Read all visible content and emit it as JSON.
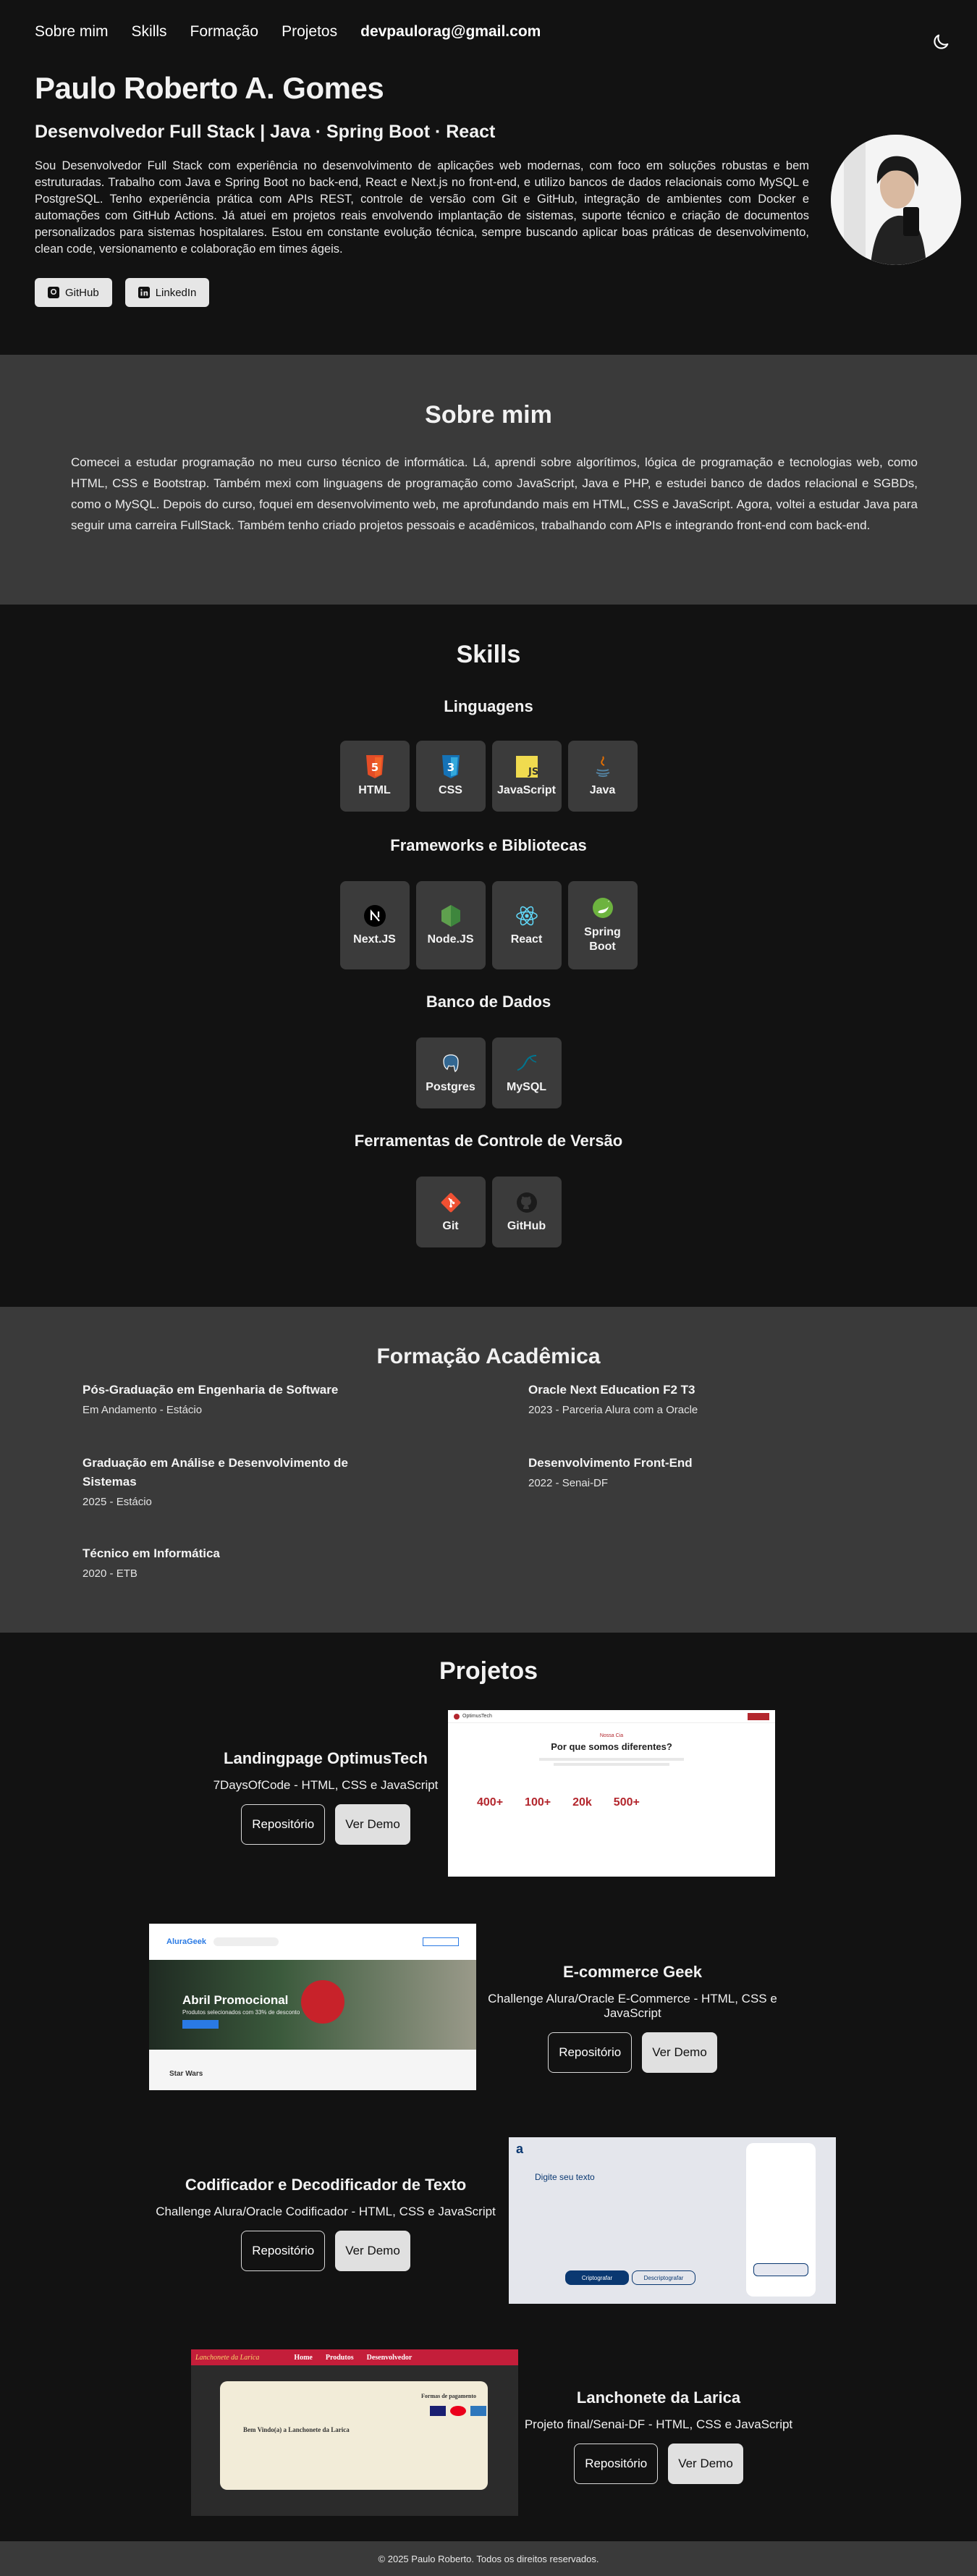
{
  "nav": {
    "items": [
      "Sobre mim",
      "Skills",
      "Formação",
      "Projetos"
    ],
    "email": "devpaulorag@gmail.com"
  },
  "header": {
    "name": "Paulo Roberto A. Gomes",
    "role": "Desenvolvedor Full Stack | Java · Spring Boot · React",
    "bio": "Sou Desenvolvedor Full Stack com experiência no desenvolvimento de aplicações web modernas, com foco em soluções robustas e bem estruturadas. Trabalho com Java e Spring Boot no back-end, React e Next.js no front-end, e utilizo bancos de dados relacionais como MySQL e PostgreSQL. Tenho experiência prática com APIs REST, controle de versão com Git e GitHub, integração de ambientes com Docker e automações com GitHub Actions. Já atuei em projetos reais envolvendo implantação de sistemas, suporte técnico e criação de documentos personalizados para sistemas hospitalares. Estou em constante evolução técnica, sempre buscando aplicar boas práticas de desenvolvimento, clean code, versionamento e colaboração em times ágeis.",
    "github_label": "GitHub",
    "linkedin_label": "LinkedIn"
  },
  "about": {
    "title": "Sobre mim",
    "text": "Comecei a estudar programação no meu curso técnico de informática. Lá, aprendi sobre algorítimos, lógica de programação e tecnologias web, como HTML, CSS e Bootstrap. Também mexi com linguagens de programação como JavaScript, Java e PHP, e estudei banco de dados relacional e SGBDs, como o MySQL. Depois do curso, foquei em desenvolvimento web, me aprofundando mais em HTML, CSS e JavaScript. Agora, voltei a estudar Java para seguir uma carreira FullStack. Também tenho criado projetos pessoais e acadêmicos, trabalhando com APIs e integrando front-end com back-end."
  },
  "skills": {
    "title": "Skills",
    "languages": {
      "title": "Linguagens",
      "items": [
        "HTML",
        "CSS",
        "JavaScript",
        "Java"
      ]
    },
    "frameworks": {
      "title": "Frameworks e Bibliotecas",
      "items": [
        "Next.JS",
        "Node.JS",
        "React",
        "Spring Boot"
      ]
    },
    "databases": {
      "title": "Banco de Dados",
      "items": [
        "Postgres",
        "MySQL"
      ]
    },
    "vcs": {
      "title": "Ferramentas de Controle de Versão",
      "items": [
        "Git",
        "GitHub"
      ]
    }
  },
  "education": {
    "title": "Formação Acadêmica",
    "items": [
      {
        "title": "Pós-Graduação em Engenharia de Software",
        "sub": "Em Andamento - Estácio"
      },
      {
        "title": "Oracle Next Education F2 T3",
        "sub": "2023 - Parceria Alura com a Oracle"
      },
      {
        "title": "Graduação em Análise e Desenvolvimento de Sistemas",
        "sub": "2025 - Estácio"
      },
      {
        "title": "Desenvolvimento Front-End",
        "sub": "2022 - Senai-DF"
      },
      {
        "title": "Técnico em Informática",
        "sub": "2020 - ETB"
      }
    ]
  },
  "projects": {
    "title": "Projetos",
    "repo_label": "Repositório",
    "demo_label": "Ver Demo",
    "items": [
      {
        "title": "Landingpage OptimusTech",
        "desc": "7DaysOfCode - HTML, CSS e JavaScript"
      },
      {
        "title": "E-commerce Geek",
        "desc": "Challenge Alura/Oracle E-Commerce - HTML, CSS e JavaScript"
      },
      {
        "title": "Codificador e Decodificador de Texto",
        "desc": "Challenge Alura/Oracle Codificador - HTML, CSS e JavaScript"
      },
      {
        "title": "Lanchonete da Larica",
        "desc": "Projeto final/Senai-DF - HTML, CSS e JavaScript"
      }
    ]
  },
  "shots": {
    "optimus": {
      "brand": "OptimusTech",
      "eyebrow": "Nossa Cia",
      "heading": "Por que somos diferentes?",
      "stats": [
        "400+",
        "100+",
        "20k",
        "500+"
      ]
    },
    "geek": {
      "brand": "AluraGeek",
      "banner": "Abril Promocional",
      "banner_sub": "Produtos selecionados com 33% de desconto",
      "section": "Star Wars"
    },
    "coder": {
      "placeholder": "Digite seu texto",
      "btn1": "Criptografar",
      "btn2": "Descriptografar"
    },
    "larica": {
      "brand": "Lanchonete da Larica",
      "nav": [
        "Home",
        "Produtos",
        "Desenvolvedor"
      ],
      "welcome": "Bem Vindo(a) a Lanchonete da Larica",
      "pay": "Formas de pagamento"
    }
  },
  "footer": {
    "text": "© 2025 Paulo Roberto. Todos os direitos reservados."
  }
}
